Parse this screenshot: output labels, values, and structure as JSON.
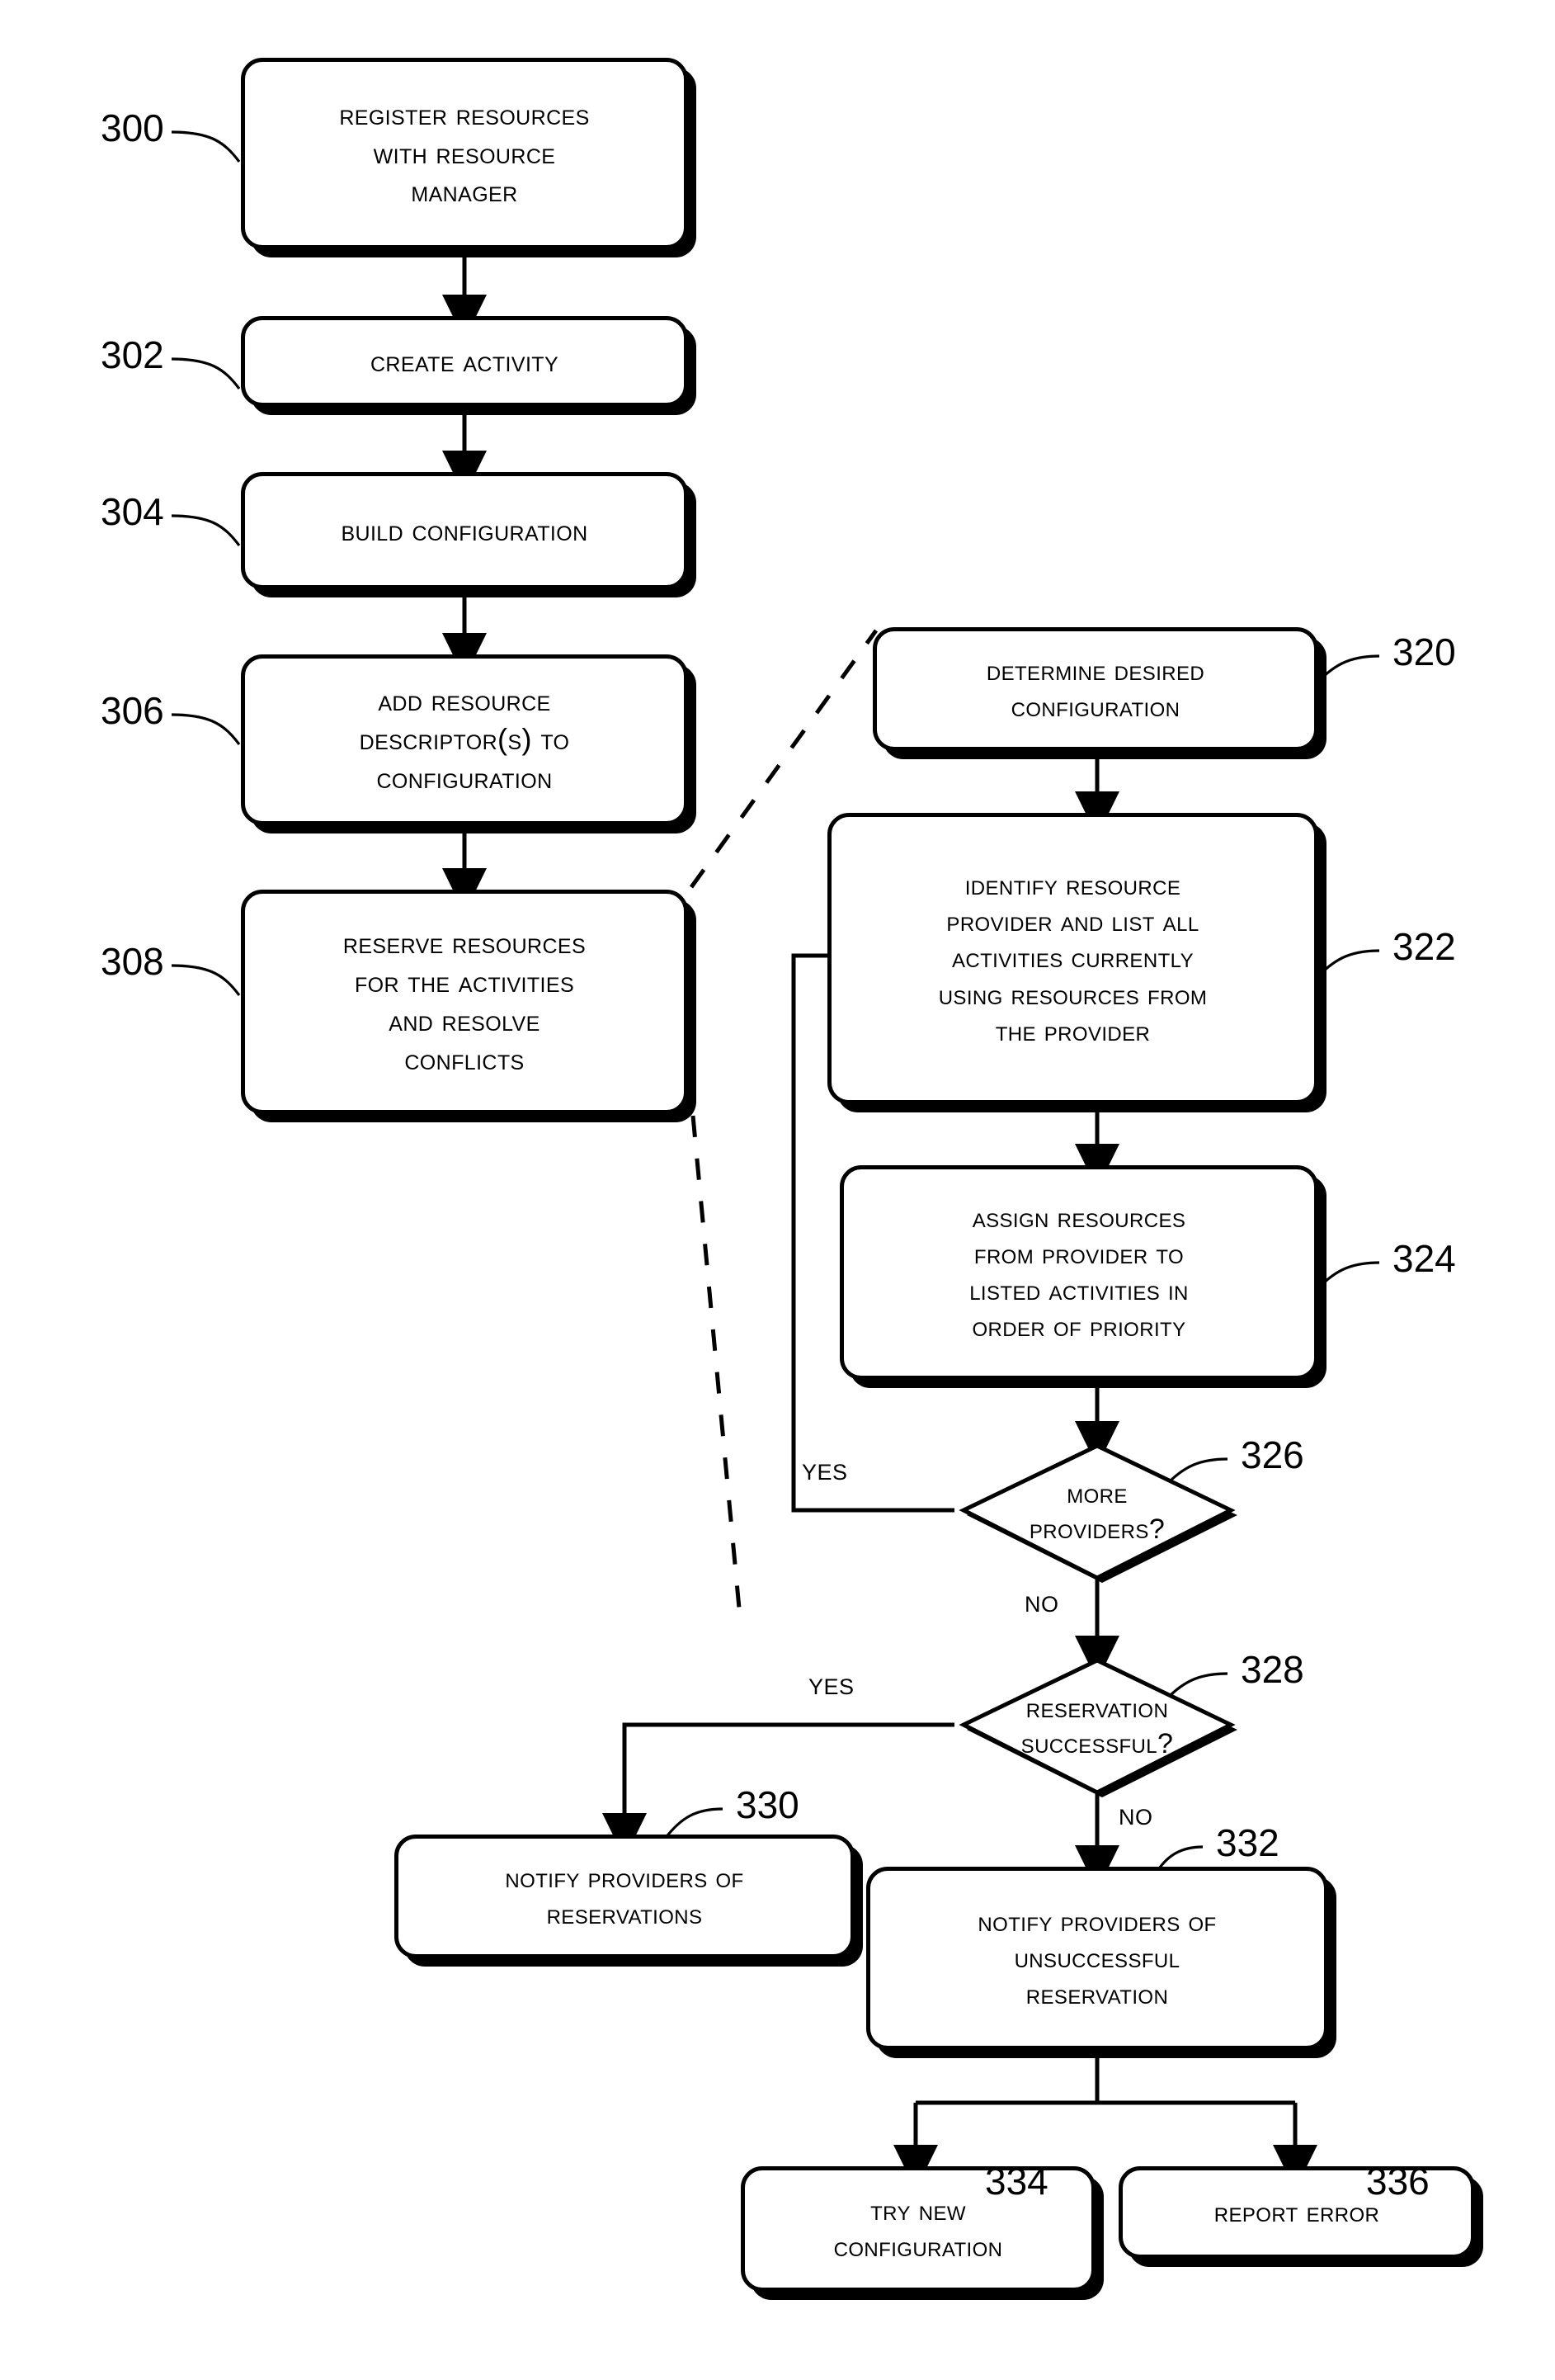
{
  "figure": {
    "kind": "patent-flowchart",
    "background": "#ffffff",
    "ink": "#000000"
  },
  "nodes": {
    "n300": {
      "ref": "300",
      "lines": [
        "Register Resources",
        "with Resource",
        "Manager"
      ]
    },
    "n302": {
      "ref": "302",
      "lines": [
        "Create Activity"
      ]
    },
    "n304": {
      "ref": "304",
      "lines": [
        "Build Configuration"
      ]
    },
    "n306": {
      "ref": "306",
      "lines": [
        "Add Resource",
        "Descriptor(s) to",
        "Configuration"
      ]
    },
    "n308": {
      "ref": "308",
      "lines": [
        "Reserve Resources",
        "For The Activities",
        "And Resolve",
        "Conflicts"
      ]
    },
    "n320": {
      "ref": "320",
      "lines": [
        "Determine Desired",
        "Configuration"
      ]
    },
    "n322": {
      "ref": "322",
      "lines": [
        "Identify Resource",
        "Provider and List All",
        "Activities Currently",
        "Using resources From",
        "The Provider"
      ]
    },
    "n324": {
      "ref": "324",
      "lines": [
        "Assign Resources",
        "From Provider To",
        "listed Activities In",
        "Order Of Priority"
      ]
    },
    "n326": {
      "ref": "326",
      "lines": [
        "More",
        "Providers?"
      ]
    },
    "n328": {
      "ref": "328",
      "lines": [
        "Reservation",
        "Successful?"
      ]
    },
    "n330": {
      "ref": "330",
      "lines": [
        "Notify Providers of",
        "Reservations"
      ]
    },
    "n332": {
      "ref": "332",
      "lines": [
        "Notify Providers of",
        "Unsuccessful",
        "Reservation"
      ]
    },
    "n334": {
      "ref": "334",
      "lines": [
        "Try New",
        "Configuration"
      ]
    },
    "n336": {
      "ref": "336",
      "lines": [
        "Report Error"
      ]
    }
  },
  "edge_labels": {
    "more_providers_yes": "Yes",
    "more_providers_no": "No",
    "reservation_yes": "Yes",
    "reservation_no": "No"
  }
}
